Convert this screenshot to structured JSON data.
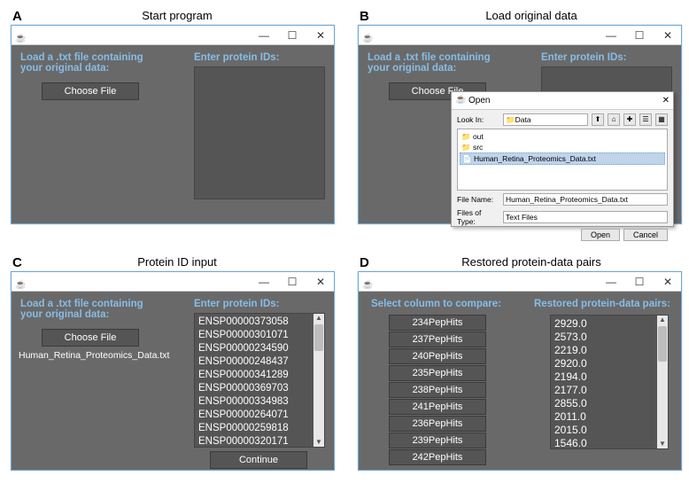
{
  "panels": {
    "A": {
      "label": "A",
      "title": "Start program"
    },
    "B": {
      "label": "B",
      "title": "Load original data"
    },
    "C": {
      "label": "C",
      "title": "Protein ID input"
    },
    "D": {
      "label": "D",
      "title": "Restored protein-data pairs"
    }
  },
  "window_controls": {
    "min": "—",
    "max": "☐",
    "close": "✕"
  },
  "common": {
    "load_label_l1": "Load a .txt file containing",
    "load_label_l2": "your original data:",
    "choose_file": "Choose File",
    "enter_ids": "Enter protein IDs:"
  },
  "panelC": {
    "filename": "Human_Retina_Proteomics_Data.txt",
    "ids": [
      "ENSP00000373058",
      "ENSP00000301071",
      "ENSP00000234590",
      "ENSP00000248437",
      "ENSP00000341289",
      "ENSP00000369703",
      "ENSP00000334983",
      "ENSP00000264071",
      "ENSP00000259818",
      "ENSP00000320171"
    ],
    "continue": "Continue"
  },
  "panelD": {
    "select_label": "Select column to compare:",
    "pairs_label": "Restored protein-data pairs:",
    "columns": [
      "234PepHits",
      "237PepHits",
      "240PepHits",
      "235PepHits",
      "238PepHits",
      "241PepHits",
      "236PepHits",
      "239PepHits",
      "242PepHits"
    ],
    "values": [
      "2929.0",
      "2573.0",
      "2219.0",
      "2920.0",
      "2194.0",
      "2177.0",
      "2855.0",
      "2011.0",
      "2015.0",
      "1546.0"
    ]
  },
  "dialog": {
    "title": "Open",
    "lookin_label": "Look In:",
    "lookin_value": "Data",
    "files": [
      {
        "name": "out",
        "sel": false
      },
      {
        "name": "src",
        "sel": false
      },
      {
        "name": "Human_Retina_Proteomics_Data.txt",
        "sel": true
      }
    ],
    "filename_label": "File Name:",
    "filename_value": "Human_Retina_Proteomics_Data.txt",
    "type_label": "Files of Type:",
    "type_value": "Text Files",
    "open": "Open",
    "cancel": "Cancel"
  }
}
